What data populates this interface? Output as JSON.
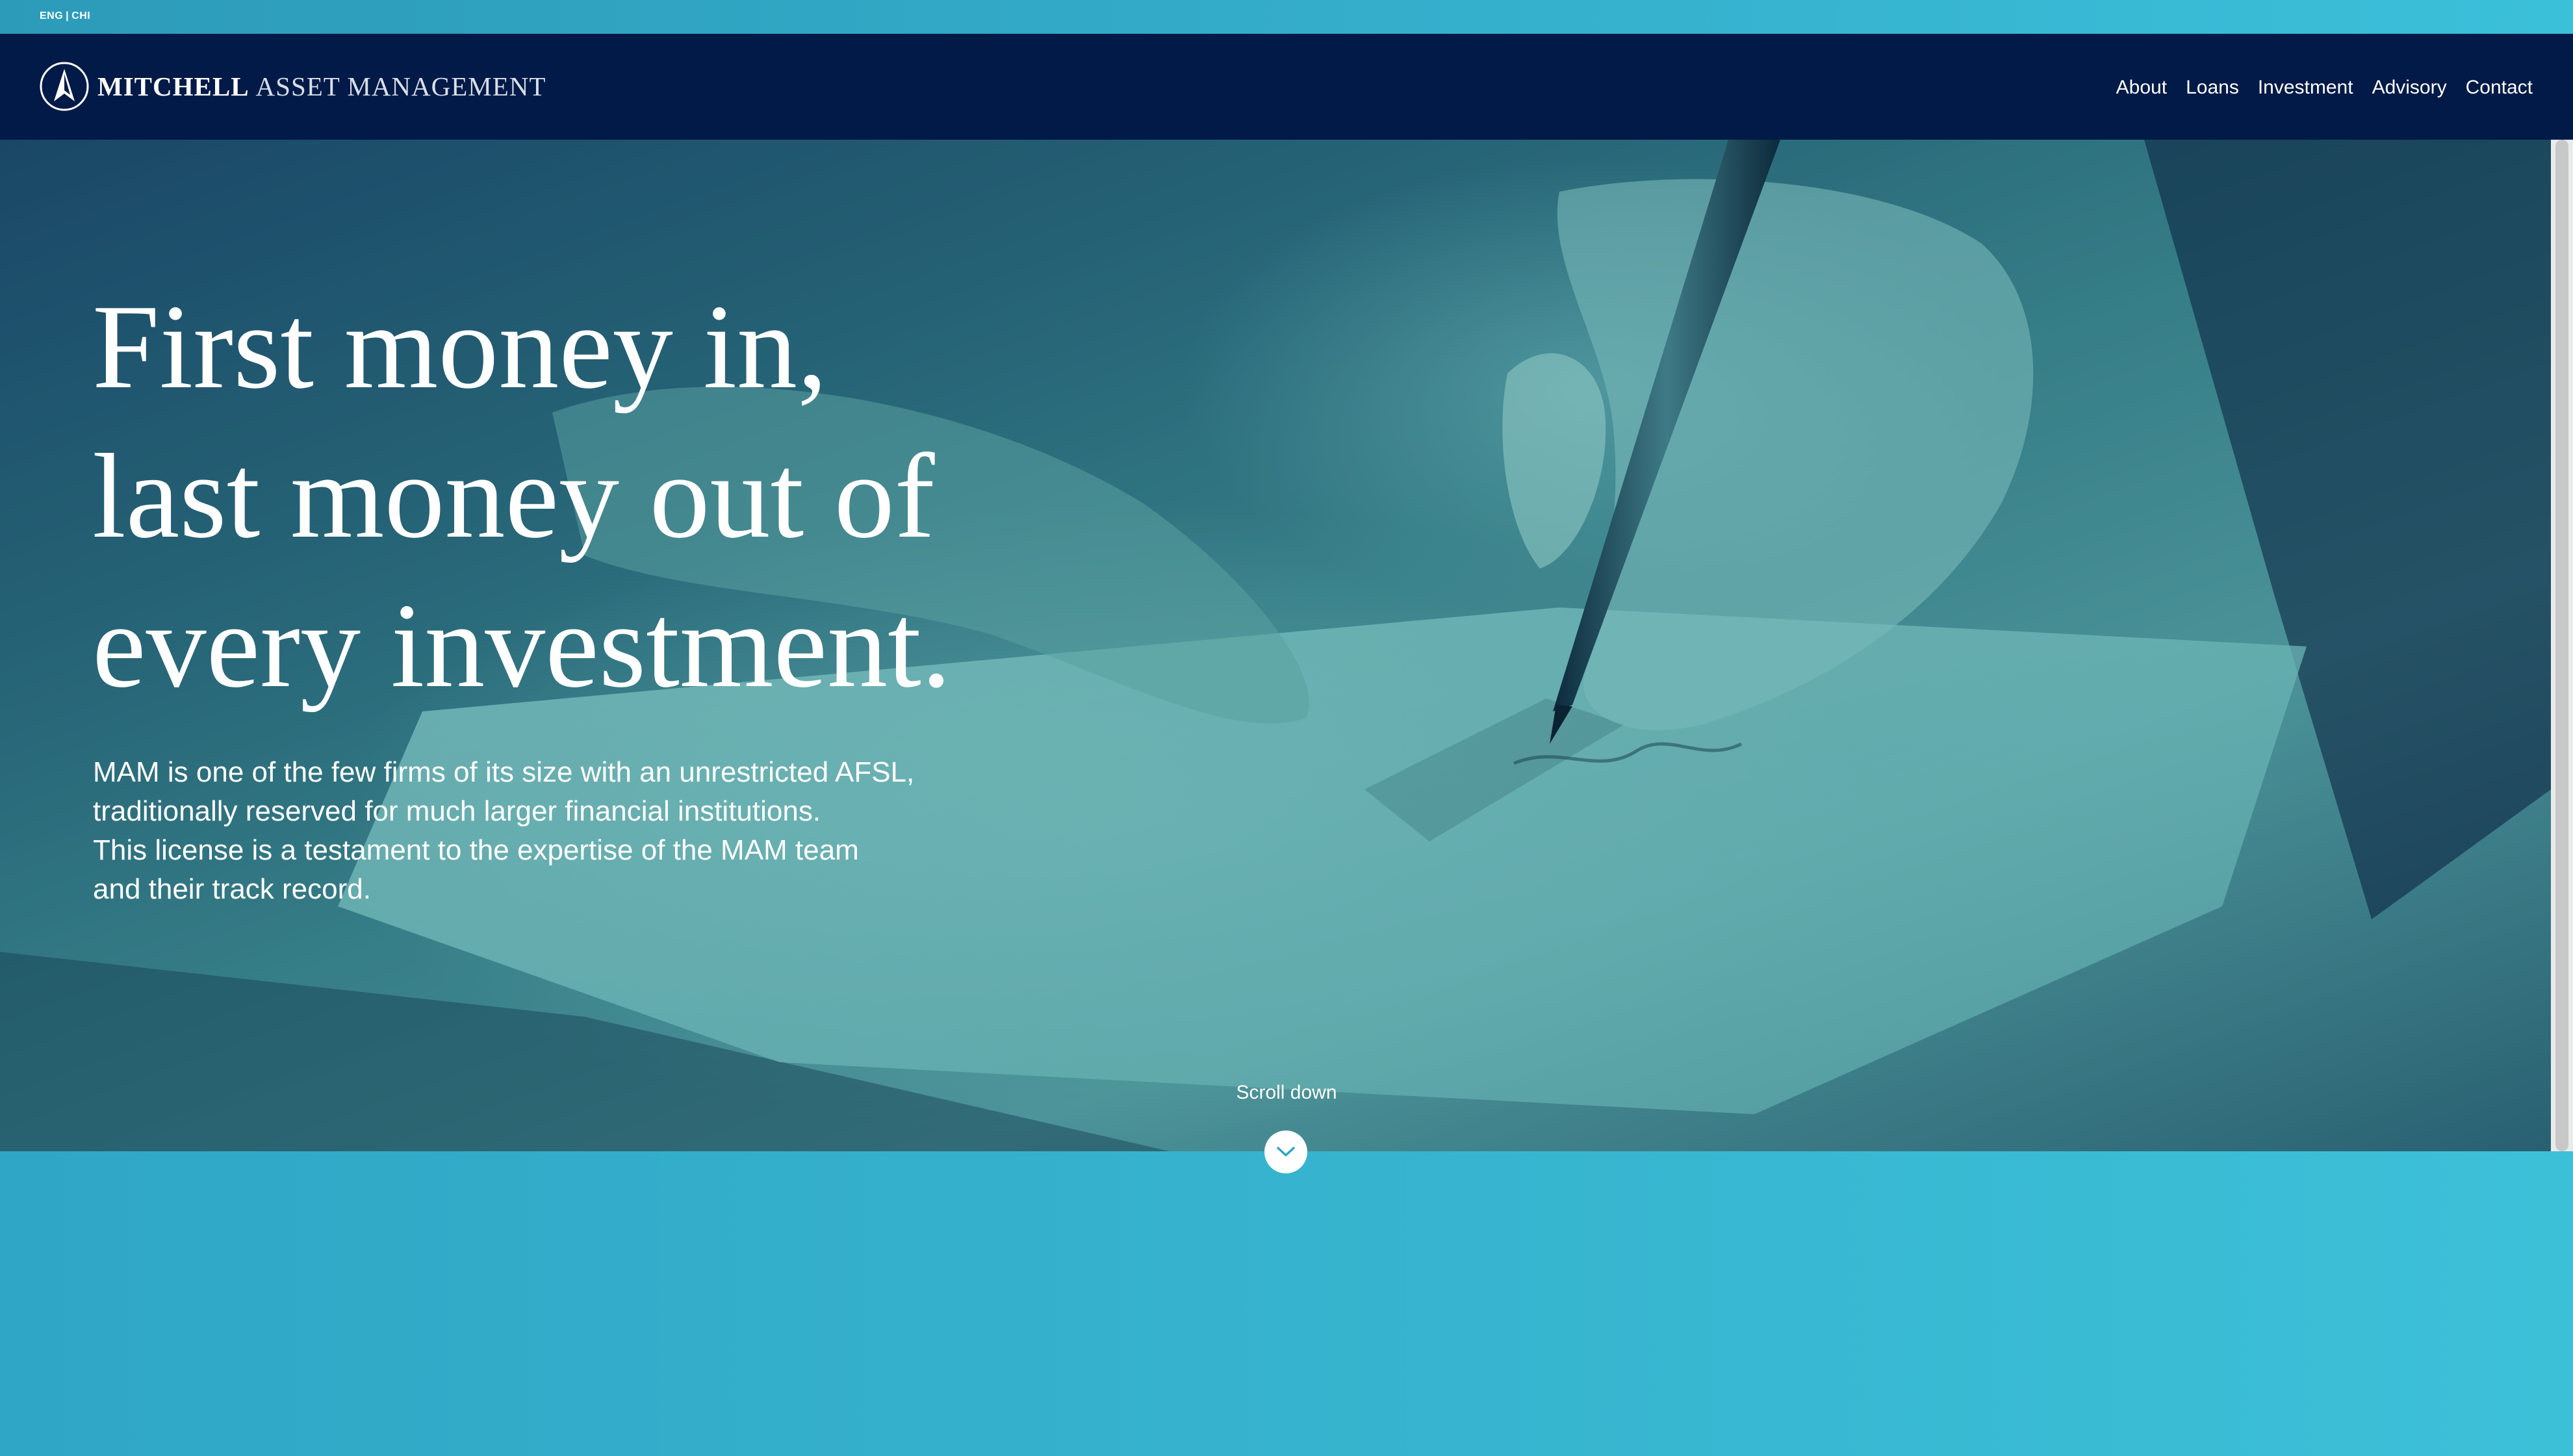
{
  "lang": {
    "english": "ENG",
    "separator": "|",
    "chinese": "CHI"
  },
  "brand": {
    "name_strong": "MITCHELL",
    "name_light": "ASSET MANAGEMENT",
    "logo_icon": "compass-a-icon"
  },
  "nav": {
    "items": [
      {
        "label": "About"
      },
      {
        "label": "Loans"
      },
      {
        "label": "Investment"
      },
      {
        "label": "Advisory"
      },
      {
        "label": "Contact"
      }
    ]
  },
  "hero": {
    "headline": {
      "line1": "First money in,",
      "line2": "last money out of",
      "line3": "every investment."
    },
    "intro": {
      "line1": "MAM is one of the few firms of its size with an unrestricted AFSL,",
      "line2": "traditionally reserved for much larger financial institutions.",
      "line3": "This license is a testament to the expertise of the MAM team",
      "line4": "and their track record."
    },
    "slides": {
      "count": 3,
      "active_index": 1
    },
    "scroll_label": "Scroll down",
    "scroll_icon": "chevron-down-icon"
  },
  "colors": {
    "header_navy": "#021a48",
    "accent_teal": "#3fc0da",
    "text_white": "#ffffff"
  }
}
